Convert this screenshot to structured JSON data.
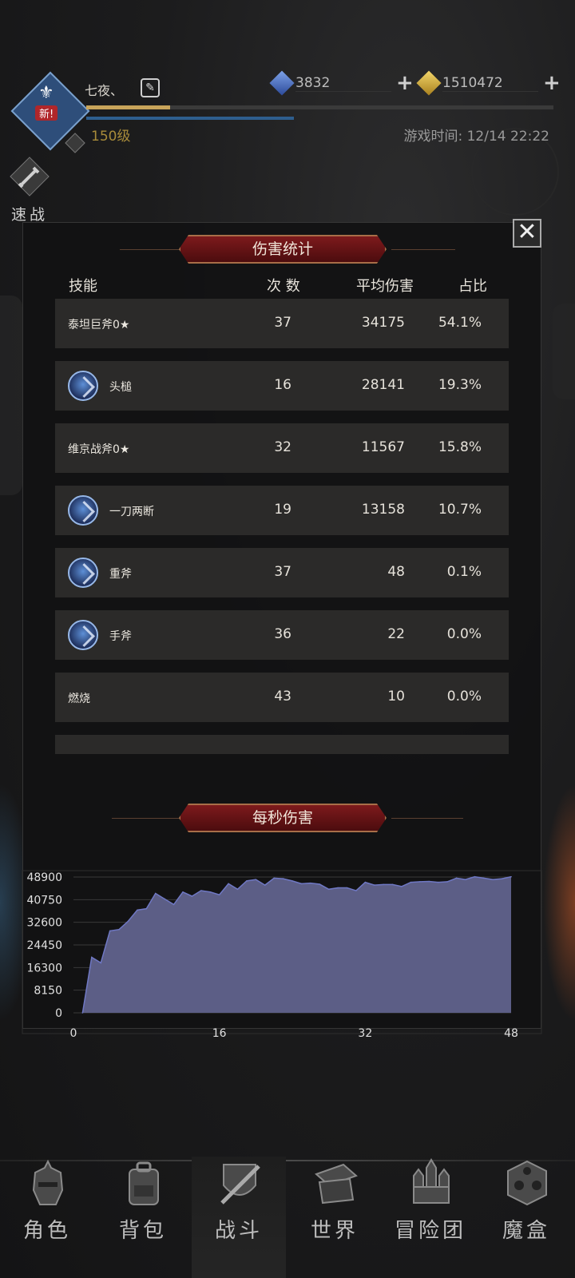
{
  "header": {
    "avatar_badge": "新!",
    "player_name": "七夜、",
    "level": "150级",
    "game_time": "游戏时间: 12/14 22:22",
    "xp_progress": 0.18
  },
  "currency": {
    "gems": "3832",
    "gold": "1510472"
  },
  "quick_battle": {
    "label": "速战"
  },
  "damage_panel": {
    "title": "伤害统计",
    "columns": [
      "技能",
      "次 数",
      "平均伤害",
      "占比"
    ],
    "rows": [
      {
        "name": "泰坦巨斧0★",
        "has_icon": false,
        "count": "37",
        "avg": "34175",
        "pct": "54.1%"
      },
      {
        "name": "头槌",
        "has_icon": true,
        "icon": "headbutt-skill-icon",
        "count": "16",
        "avg": "28141",
        "pct": "19.3%"
      },
      {
        "name": "维京战斧0★",
        "has_icon": false,
        "count": "32",
        "avg": "11567",
        "pct": "15.8%"
      },
      {
        "name": "一刀两断",
        "has_icon": true,
        "icon": "cleave-skill-icon",
        "count": "19",
        "avg": "13158",
        "pct": "10.7%"
      },
      {
        "name": "重斧",
        "has_icon": true,
        "icon": "heavy-axe-skill-icon",
        "count": "37",
        "avg": "48",
        "pct": "0.1%"
      },
      {
        "name": "手斧",
        "has_icon": true,
        "icon": "hand-axe-skill-icon",
        "count": "36",
        "avg": "22",
        "pct": "0.0%"
      },
      {
        "name": "燃烧",
        "has_icon": false,
        "count": "43",
        "avg": "10",
        "pct": "0.0%"
      }
    ]
  },
  "dps_section": {
    "title": "每秒伤害"
  },
  "chart_data": {
    "type": "area",
    "title": "每秒伤害",
    "xlabel": "",
    "ylabel": "",
    "xlim": [
      0,
      48
    ],
    "ylim": [
      0,
      48900
    ],
    "x_ticks": [
      "0",
      "16",
      "32",
      "48"
    ],
    "y_ticks": [
      "48900",
      "40750",
      "32600",
      "24450",
      "16300",
      "8150",
      "0"
    ],
    "x": [
      1,
      2,
      3,
      4,
      5,
      6,
      7,
      8,
      9,
      10,
      11,
      12,
      13,
      14,
      15,
      16,
      17,
      18,
      19,
      20,
      21,
      22,
      23,
      24,
      25,
      26,
      27,
      28,
      29,
      30,
      31,
      32,
      33,
      34,
      35,
      36,
      37,
      38,
      39,
      40,
      41,
      42,
      43,
      44,
      45,
      46,
      47,
      48
    ],
    "values": [
      0,
      20000,
      18000,
      29500,
      30000,
      33000,
      37000,
      37500,
      43000,
      41000,
      39000,
      43500,
      42000,
      44000,
      43500,
      42500,
      46500,
      44500,
      47500,
      48000,
      46000,
      48500,
      48300,
      47500,
      46500,
      46700,
      46300,
      44500,
      45000,
      45000,
      44000,
      47000,
      46000,
      46200,
      46200,
      45500,
      47000,
      47200,
      47300,
      47000,
      47200,
      48500,
      48000,
      49000,
      48500,
      48000,
      48300,
      49000
    ],
    "grid": true,
    "fill_color": "#5c5e86",
    "line_color": "#6f78c4"
  },
  "nav": {
    "items": [
      {
        "label": "角色",
        "icon": "knight-helmet-icon"
      },
      {
        "label": "背包",
        "icon": "backpack-icon"
      },
      {
        "label": "战斗",
        "icon": "shield-sword-icon"
      },
      {
        "label": "世界",
        "icon": "map-scroll-icon"
      },
      {
        "label": "冒险团",
        "icon": "castle-icon"
      },
      {
        "label": "魔盒",
        "icon": "magic-cube-icon"
      }
    ],
    "active_index": 2
  },
  "colors": {
    "banner_red": "#7d1a1c",
    "row_bg": "#2b2a29",
    "gold_text": "#a88b3a"
  }
}
